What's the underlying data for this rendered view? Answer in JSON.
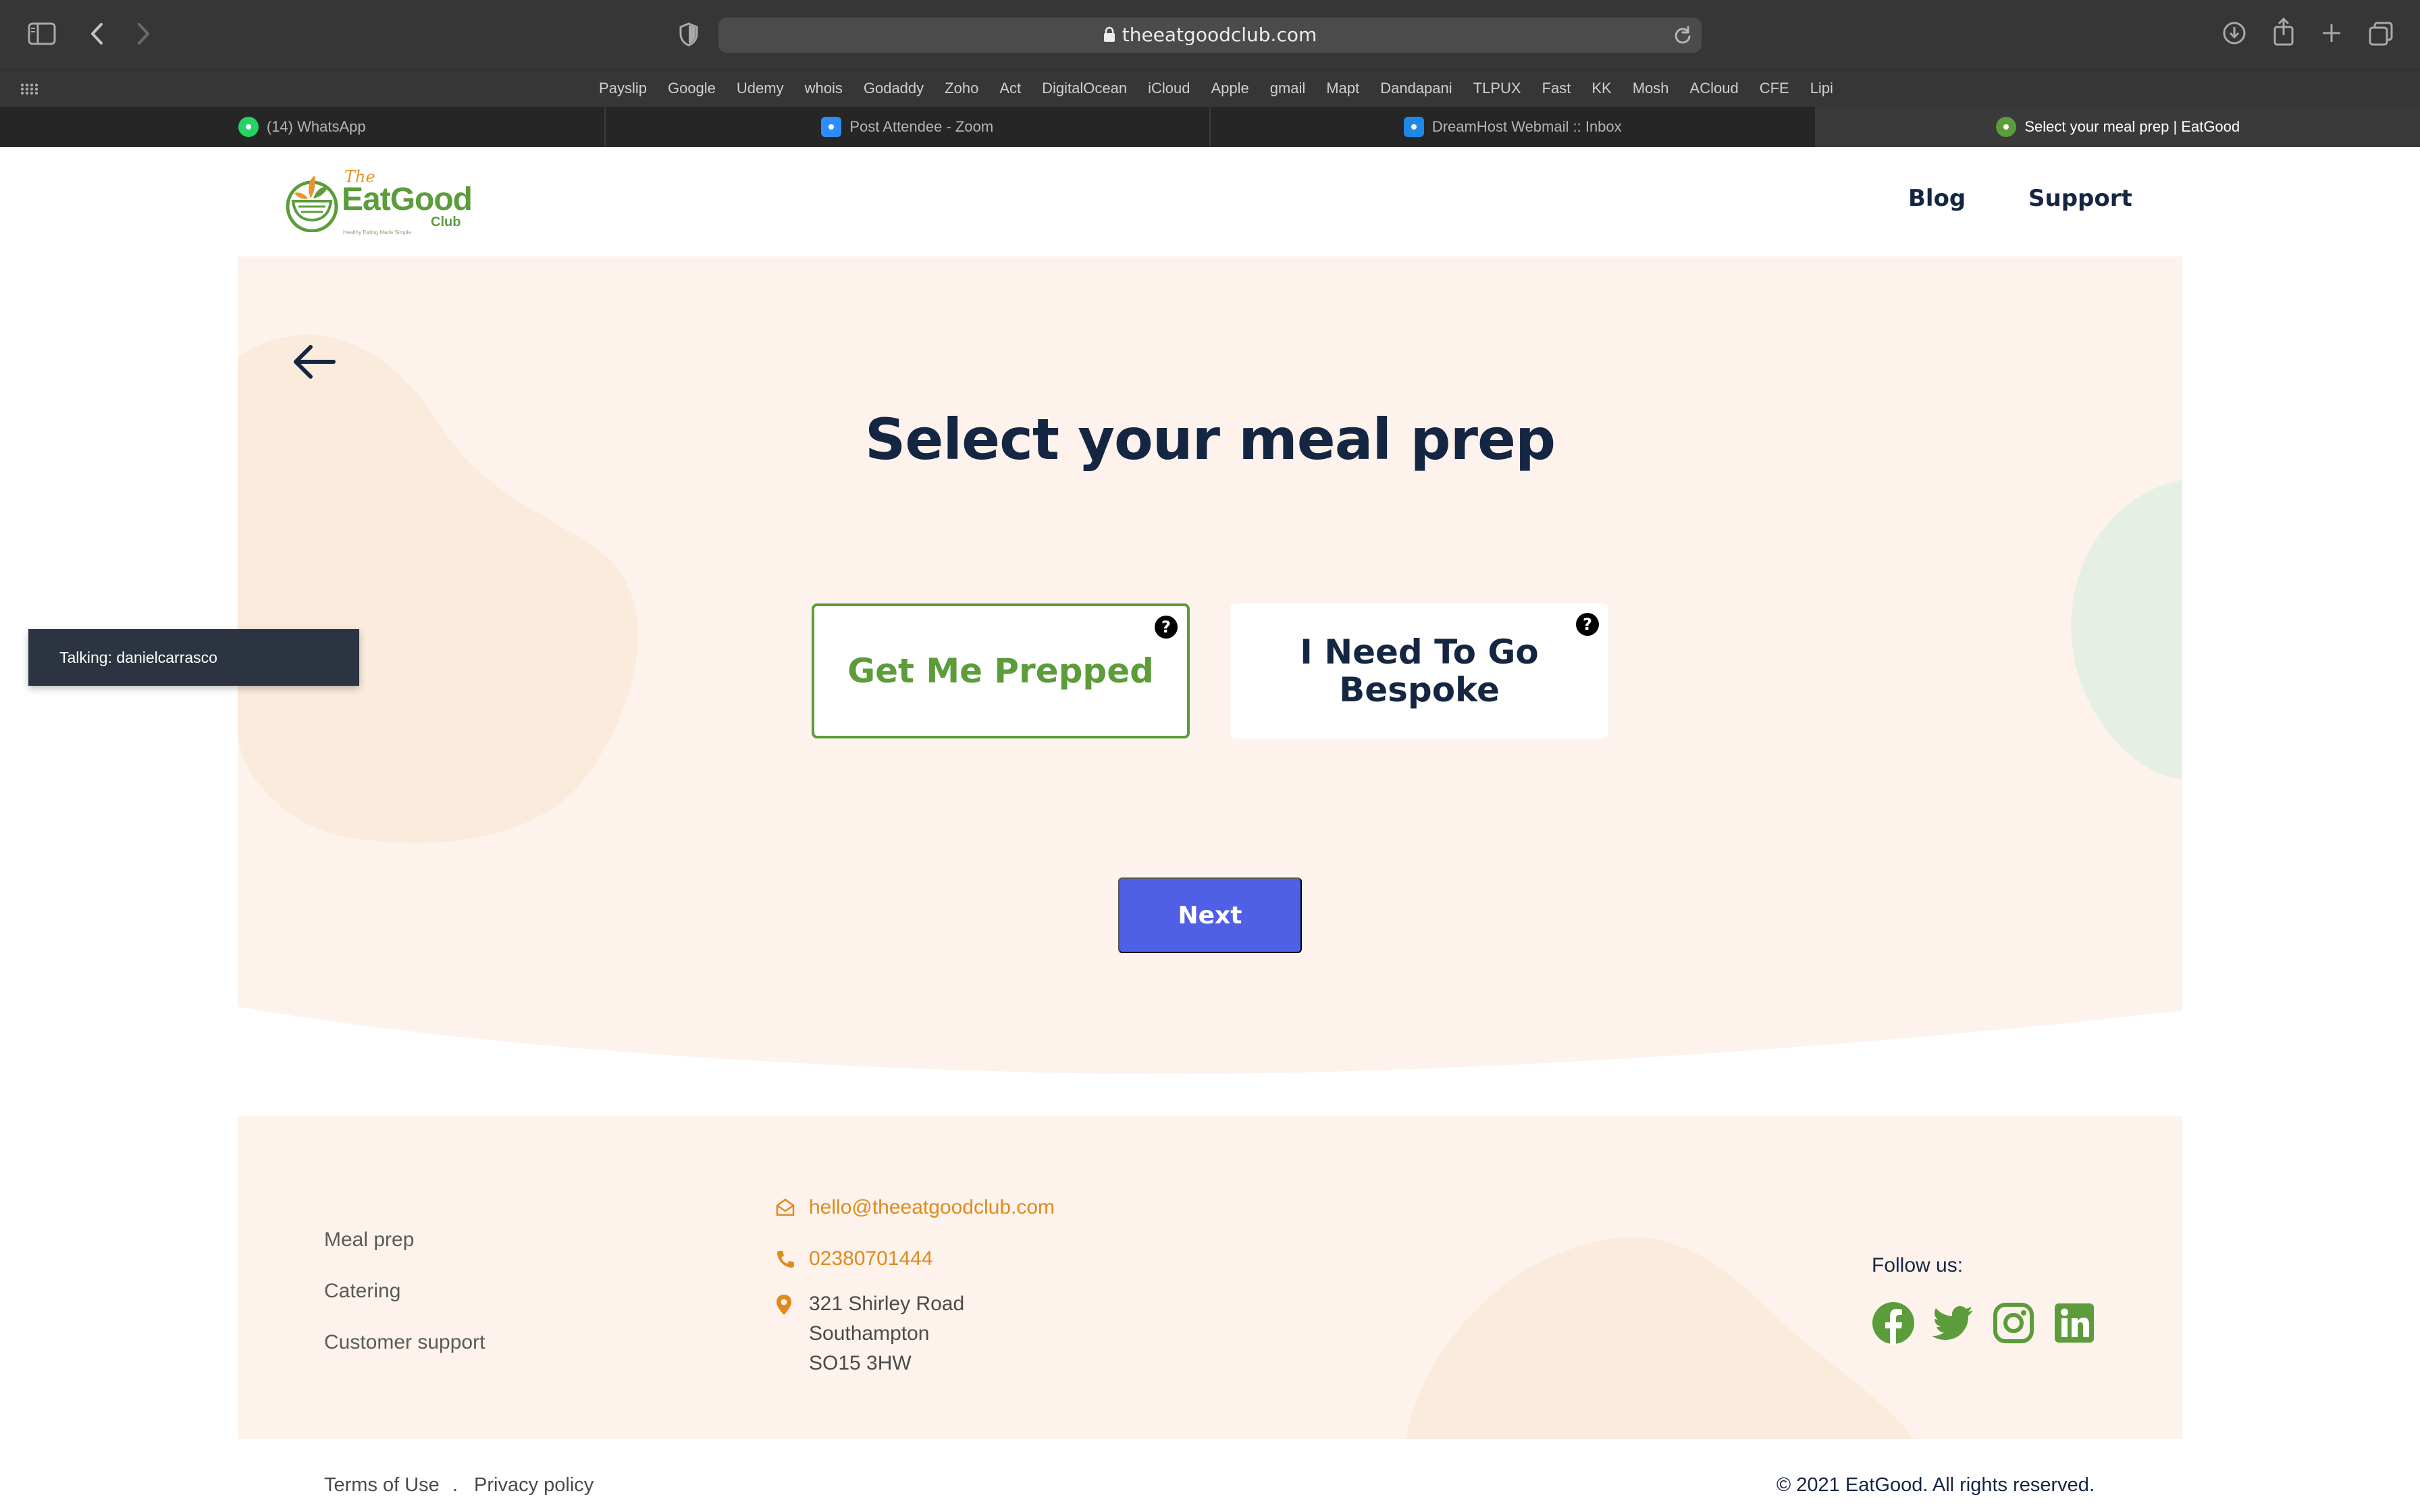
{
  "browser": {
    "url": "theeatgoodclub.com",
    "favorites": [
      "Payslip",
      "Google",
      "Udemy",
      "whois",
      "Godaddy",
      "Zoho",
      "Act",
      "DigitalOcean",
      "iCloud",
      "Apple",
      "gmail",
      "Mapt",
      "Dandapani",
      "TLPUX",
      "Fast",
      "KK",
      "Mosh",
      "ACloud",
      "CFE",
      "Lipi"
    ],
    "tabs": [
      {
        "title": "(14) WhatsApp",
        "icon": "whatsapp-icon",
        "color": "#25d366"
      },
      {
        "title": "Post Attendee - Zoom",
        "icon": "zoom-icon",
        "color": "#2d8cff"
      },
      {
        "title": "DreamHost Webmail :: Inbox",
        "icon": "dreamhost-icon",
        "color": "#1e88e5"
      },
      {
        "title": "Select your meal prep | EatGood",
        "icon": "eatgood-icon",
        "color": "#5c9c3a",
        "active": true
      }
    ]
  },
  "logo": {
    "the": "The",
    "main": "EatGood",
    "club": "Club",
    "tagline": "Healthy Eating Made Simple"
  },
  "nav": {
    "blog": "Blog",
    "support": "Support"
  },
  "hero": {
    "title": "Select your meal prep",
    "options": [
      {
        "label": "Get Me Prepped",
        "selected": true
      },
      {
        "label": "I Need To Go Bespoke",
        "selected": false
      }
    ],
    "help_glyph": "?",
    "next_label": "Next"
  },
  "footer": {
    "links": [
      "Meal prep",
      "Catering",
      "Customer support"
    ],
    "email": "hello@theeatgoodclub.com",
    "phone": "02380701444",
    "address": [
      "321 Shirley Road",
      "Southampton",
      "SO15 3HW"
    ],
    "follow_label": "Follow us:",
    "social": [
      "facebook-icon",
      "twitter-icon",
      "instagram-icon",
      "linkedin-icon"
    ]
  },
  "bottom": {
    "terms": "Terms of Use",
    "separator": ".",
    "privacy": "Privacy policy",
    "copyright": "© 2021 EatGood. All rights reserved."
  },
  "overlay": {
    "talking": "Talking: danielcarrasco"
  },
  "colors": {
    "brand_green": "#5c9c3a",
    "navy": "#152642",
    "accent_orange": "#e08a1e",
    "button_blue": "#5060e6",
    "hero_bg": "#fdf3ec"
  }
}
